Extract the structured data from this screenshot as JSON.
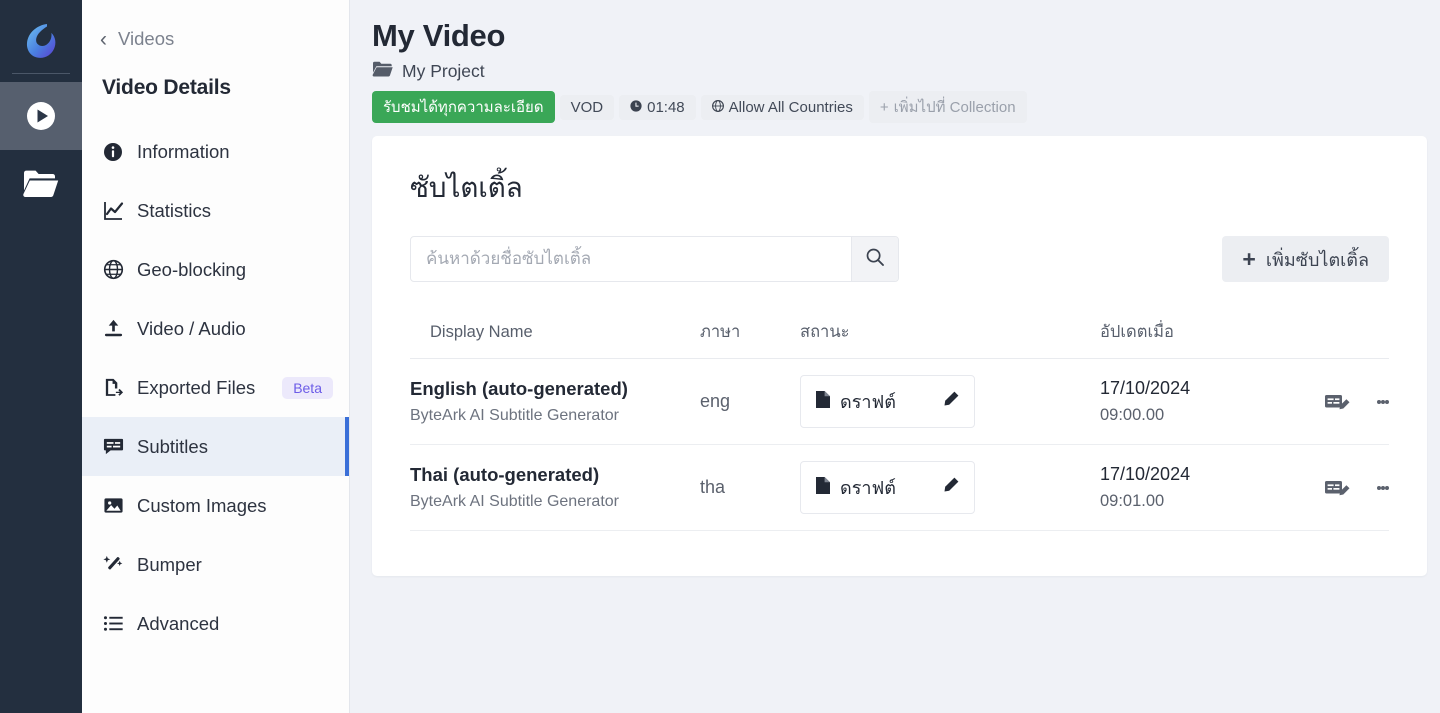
{
  "rail": {
    "logo_name": "bytearkstream-logo",
    "items": [
      {
        "icon": "play-circle-icon",
        "name": "videos",
        "active": true
      },
      {
        "icon": "folder-icon",
        "name": "projects",
        "active": false
      }
    ]
  },
  "sidebar": {
    "back_label": "Videos",
    "title": "Video Details",
    "items": [
      {
        "label": "Information",
        "icon": "info-circle-icon",
        "active": false
      },
      {
        "label": "Statistics",
        "icon": "chart-line-icon",
        "active": false
      },
      {
        "label": "Geo-blocking",
        "icon": "globe-icon",
        "active": false
      },
      {
        "label": "Video / Audio",
        "icon": "upload-icon",
        "active": false
      },
      {
        "label": "Exported Files",
        "icon": "file-export-icon",
        "active": false,
        "badge": "Beta"
      },
      {
        "label": "Subtitles",
        "icon": "subtitles-icon",
        "active": true
      },
      {
        "label": "Custom Images",
        "icon": "image-icon",
        "active": false
      },
      {
        "label": "Bumper",
        "icon": "magic-wand-icon",
        "active": false
      },
      {
        "label": "Advanced",
        "icon": "list-icon",
        "active": false
      }
    ]
  },
  "header": {
    "title": "My Video",
    "project": "My Project",
    "project_icon": "folder-open-icon",
    "chips": [
      {
        "label": "รับชมได้ทุกความละเอียด",
        "style": "green",
        "icon": ""
      },
      {
        "label": "VOD",
        "style": "default",
        "icon": ""
      },
      {
        "label": "01:48",
        "style": "default",
        "icon": "clock-icon"
      },
      {
        "label": "Allow All Countries",
        "style": "default",
        "icon": "globe-small-icon"
      },
      {
        "label": "เพิ่มไปที่ Collection",
        "style": "muted",
        "icon": "plus-small-icon"
      }
    ]
  },
  "subtitles_panel": {
    "title": "ซับไตเติ้ล",
    "search_placeholder": "ค้นหาด้วยชื่อซับไตเติ้ล",
    "search_value": "",
    "search_icon": "search-icon",
    "add_button_label": "เพิ่มซับไตเติ้ล",
    "add_button_icon": "plus-icon",
    "columns": [
      "Display Name",
      "ภาษา",
      "สถานะ",
      "อัปเดตเมื่อ"
    ],
    "rows": [
      {
        "name": "English (auto-generated)",
        "source": "ByteArk AI Subtitle Generator",
        "language": "eng",
        "status": "ดราฟต์",
        "status_icon": "document-icon",
        "status_edit_icon": "pencil-icon",
        "updated_date": "17/10/2024",
        "updated_time": "09:00.00",
        "action_icon": "caption-edit-icon",
        "menu_icon": "kebab-menu-icon"
      },
      {
        "name": "Thai (auto-generated)",
        "source": "ByteArk AI Subtitle Generator",
        "language": "tha",
        "status": "ดราฟต์",
        "status_icon": "document-icon",
        "status_edit_icon": "pencil-icon",
        "updated_date": "17/10/2024",
        "updated_time": "09:01.00",
        "action_icon": "caption-edit-icon",
        "menu_icon": "kebab-menu-icon"
      }
    ]
  },
  "colors": {
    "rail_bg": "#232f3f",
    "rail_active": "#565f6e",
    "page_bg": "#f0f2f7",
    "accent_blue": "#3a6fd8",
    "active_nav_bg": "#eaeff7",
    "green_badge": "#3aa757",
    "beta_bg": "#ece9fb",
    "beta_text": "#6c5ce7"
  }
}
